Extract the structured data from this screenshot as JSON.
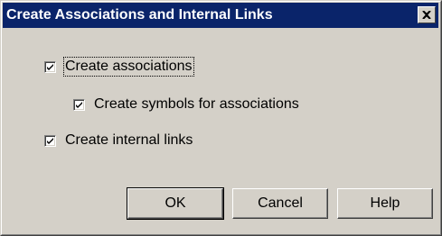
{
  "window": {
    "title": "Create Associations and Internal Links",
    "close_icon": "close-icon"
  },
  "options": {
    "create_associations": {
      "label": "Create associations",
      "checked": true
    },
    "create_symbols": {
      "label": "Create symbols for associations",
      "checked": true
    },
    "create_internal_links": {
      "label": "Create internal links",
      "checked": true
    }
  },
  "buttons": {
    "ok": "OK",
    "cancel": "Cancel",
    "help": "Help"
  },
  "colors": {
    "titlebar": "#0a246a",
    "face": "#d4d0c8"
  }
}
